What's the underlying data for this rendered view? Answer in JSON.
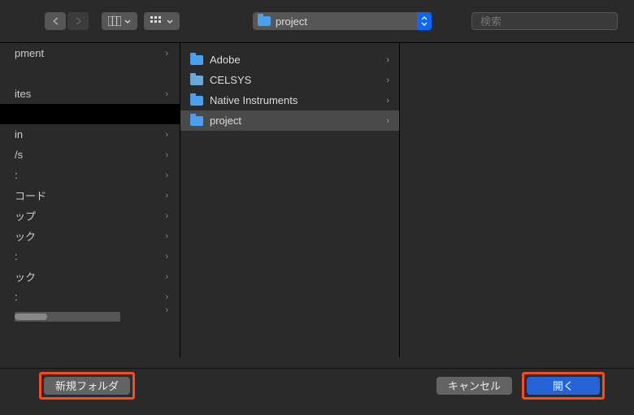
{
  "toolbar": {
    "path_label": "project",
    "search_placeholder": "検索"
  },
  "sidebar": {
    "items": [
      {
        "label": "pment"
      },
      {
        "label": ""
      },
      {
        "label": "ites"
      },
      {
        "label": "",
        "black": true
      },
      {
        "label": "in"
      },
      {
        "label": "/s"
      },
      {
        "label": ":"
      },
      {
        "label": "コード"
      },
      {
        "label": "ップ"
      },
      {
        "label": "ック"
      },
      {
        "label": ":"
      },
      {
        "label": "ック"
      },
      {
        "label": ":"
      }
    ]
  },
  "column": {
    "items": [
      {
        "label": "Adobe",
        "selected": false
      },
      {
        "label": "CELSYS",
        "selected": false,
        "dim": true
      },
      {
        "label": "Native Instruments",
        "selected": false
      },
      {
        "label": "project",
        "selected": true
      }
    ]
  },
  "footer": {
    "new_folder_label": "新規フォルダ",
    "cancel_label": "キャンセル",
    "open_label": "開く"
  }
}
